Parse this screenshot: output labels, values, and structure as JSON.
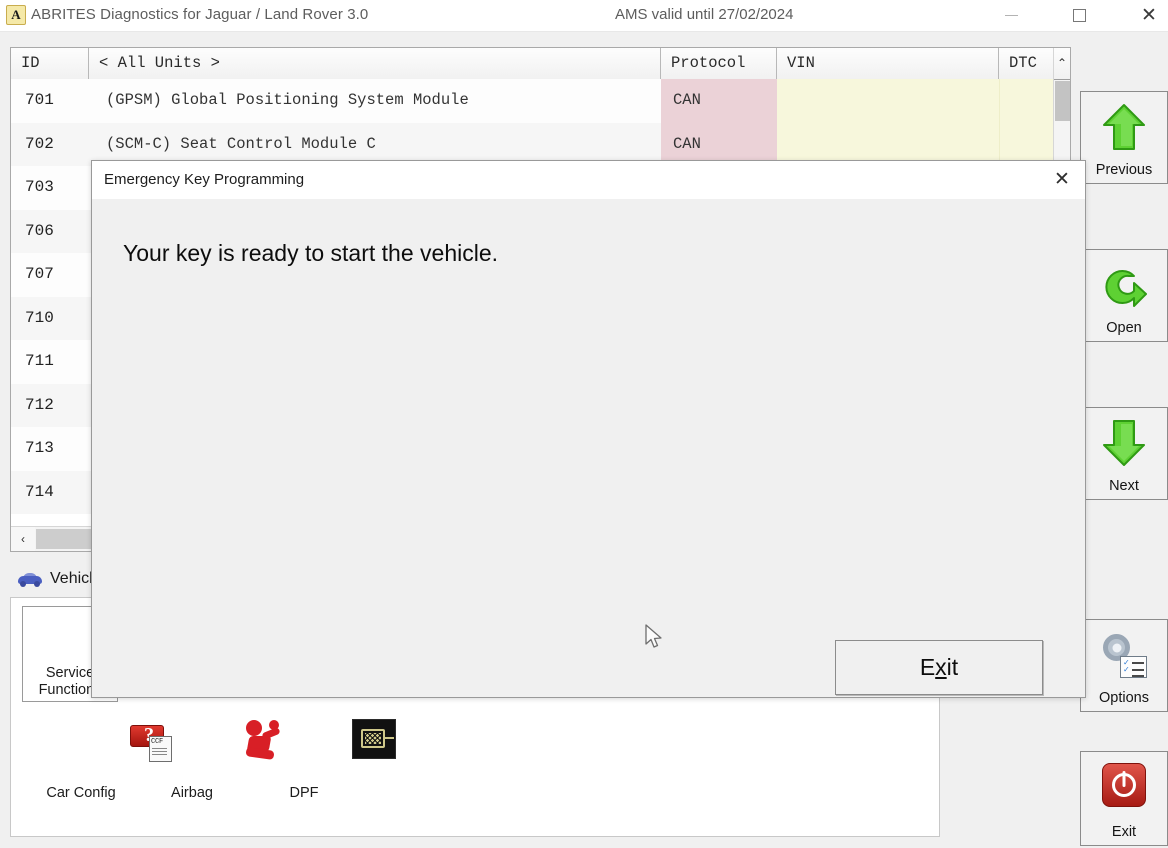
{
  "window": {
    "app_icon_letter": "A",
    "title": "ABRITES Diagnostics for Jaguar / Land Rover 3.0",
    "ams_status": "AMS valid until 27/02/2024",
    "controls": {
      "minimize": "minimize-icon",
      "maximize": "maximize-icon",
      "close": "✕"
    }
  },
  "table": {
    "headers": {
      "id": "ID",
      "units": "< All Units >",
      "protocol": "Protocol",
      "vin": "VIN",
      "dtc": "DTC"
    },
    "scroll_up_glyph": "⌃",
    "scroll_left_glyph": "‹",
    "rows": [
      {
        "id": "701",
        "name": "(GPSM) Global Positioning System Module",
        "protocol": "CAN",
        "vin": "",
        "dtc": ""
      },
      {
        "id": "702",
        "name": "(SCM-C) Seat Control Module C",
        "protocol": "CAN",
        "vin": "",
        "dtc": ""
      },
      {
        "id": "703",
        "name": "",
        "protocol": "",
        "vin": "",
        "dtc": ""
      },
      {
        "id": "706",
        "name": "",
        "protocol": "",
        "vin": "",
        "dtc": ""
      },
      {
        "id": "707",
        "name": "",
        "protocol": "",
        "vin": "",
        "dtc": ""
      },
      {
        "id": "710",
        "name": "",
        "protocol": "",
        "vin": "",
        "dtc": ""
      },
      {
        "id": "711",
        "name": "",
        "protocol": "",
        "vin": "",
        "dtc": ""
      },
      {
        "id": "712",
        "name": "",
        "protocol": "",
        "vin": "",
        "dtc": ""
      },
      {
        "id": "713",
        "name": "",
        "protocol": "",
        "vin": "",
        "dtc": ""
      },
      {
        "id": "714",
        "name": "",
        "protocol": "",
        "vin": "",
        "dtc": ""
      }
    ]
  },
  "vehicle_tab": {
    "label": "Vehicle",
    "icon": "car-icon"
  },
  "functions": [
    {
      "label_line1": "Service",
      "label_line2": "Functions",
      "icon": "tools-icon",
      "selected": true
    },
    {
      "label_line1": "Car Config",
      "label_line2": "",
      "icon": "car-config-icon",
      "selected": false
    },
    {
      "label_line1": "Airbag",
      "label_line2": "",
      "icon": "airbag-icon",
      "selected": false
    },
    {
      "label_line1": "DPF",
      "label_line2": "",
      "icon": "dpf-icon",
      "selected": false
    }
  ],
  "sidebar": [
    {
      "label": "Previous",
      "icon": "arrow-up-icon"
    },
    {
      "label": "Open",
      "icon": "open-arrow-icon"
    },
    {
      "label": "Next",
      "icon": "arrow-down-icon"
    },
    {
      "label": "Options",
      "icon": "gear-checklist-icon"
    },
    {
      "label": "Exit",
      "icon": "power-icon"
    }
  ],
  "dialog": {
    "title": "Emergency Key Programming",
    "close_glyph": "✕",
    "message": "Your key is ready to start the vehicle.",
    "exit_button": {
      "prefix": "E",
      "accel": "x",
      "suffix": "it"
    }
  },
  "colors": {
    "protocol_cell": "#ebd2d7",
    "vin_cell": "#f7f7dc",
    "window_bg": "#f0f0f0",
    "accent_green": "#4fc427",
    "accent_red": "#c0201a"
  }
}
